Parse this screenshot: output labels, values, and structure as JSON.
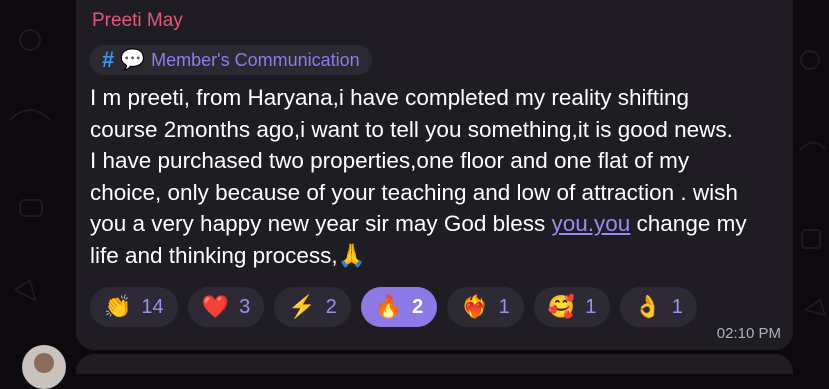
{
  "message": {
    "sender": "Preeti May",
    "topic": {
      "hash_icon": "#",
      "emoji": "💬",
      "name": "Member's Communication"
    },
    "text_before_link": "I m preeti, from Haryana,i have completed my reality shifting\ncourse 2months ago,i want to tell you something,it is good news.\nI have purchased two properties,one floor and one flat of my\nchoice, only because of your teaching and low of attraction . wish\nyou a very happy new year sir may God bless ",
    "link_text": "you.you",
    "text_after_link": " change my\nlife and thinking process,🙏",
    "time": "02:10 PM"
  },
  "reactions": [
    {
      "emoji": "👏",
      "count": "14"
    },
    {
      "emoji": "❤️",
      "count": "3"
    },
    {
      "emoji": "⚡",
      "count": "2"
    },
    {
      "emoji": "🔥",
      "count": "2"
    },
    {
      "emoji": "❤️‍🔥",
      "count": "1"
    },
    {
      "emoji": "🥰",
      "count": "1"
    },
    {
      "emoji": "👌",
      "count": "1"
    }
  ],
  "colors": {
    "sender": "#e2577a",
    "topic_name": "#8f7bf0",
    "link": "#9b8af2",
    "active_reaction": "#8e7ae6",
    "bubble": "#1f1d23"
  }
}
